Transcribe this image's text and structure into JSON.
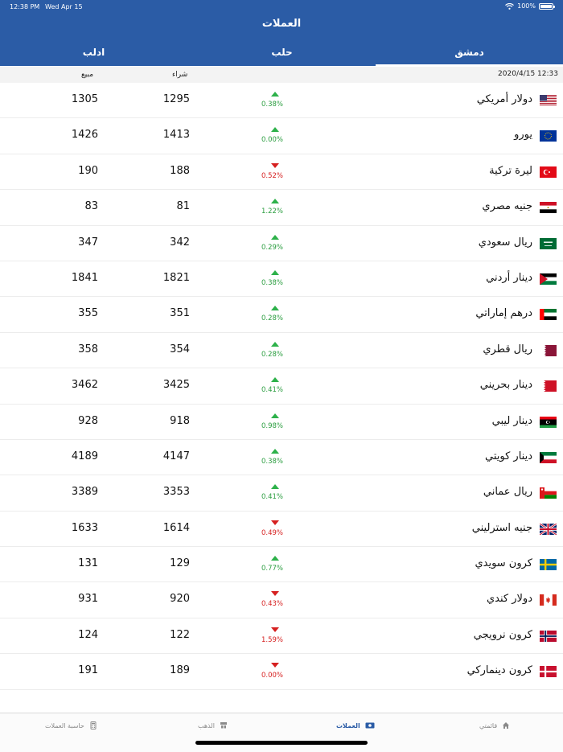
{
  "status_bar": {
    "time": "12:38 PM",
    "date": "Wed Apr 15",
    "battery": "100%"
  },
  "header": {
    "title": "العملات"
  },
  "tabs": [
    {
      "label": "دمشق",
      "active": true
    },
    {
      "label": "حلب",
      "active": false
    },
    {
      "label": "ادلب",
      "active": false
    }
  ],
  "subheader": {
    "updated": "2020/4/15 12:33",
    "buy_label": "شراء",
    "sell_label": "مبيع"
  },
  "colors": {
    "primary": "#2b5ca6",
    "up": "#2db14a",
    "down": "#d62020"
  },
  "currencies": [
    {
      "name": "دولار أمريكي",
      "flag": "us-flag",
      "direction": "up",
      "change": "0.38%",
      "buy": "1295",
      "sell": "1305"
    },
    {
      "name": "يورو",
      "flag": "eu-flag",
      "direction": "up",
      "change": "0.00%",
      "buy": "1413",
      "sell": "1426"
    },
    {
      "name": "ليرة تركية",
      "flag": "tr-flag",
      "direction": "down",
      "change": "0.52%",
      "buy": "188",
      "sell": "190"
    },
    {
      "name": "جنيه مصري",
      "flag": "eg-flag",
      "direction": "up",
      "change": "1.22%",
      "buy": "81",
      "sell": "83"
    },
    {
      "name": "ريال سعودي",
      "flag": "sa-flag",
      "direction": "up",
      "change": "0.29%",
      "buy": "342",
      "sell": "347"
    },
    {
      "name": "دينار أردني",
      "flag": "jo-flag",
      "direction": "up",
      "change": "0.38%",
      "buy": "1821",
      "sell": "1841"
    },
    {
      "name": "درهم إماراتي",
      "flag": "ae-flag",
      "direction": "up",
      "change": "0.28%",
      "buy": "351",
      "sell": "355"
    },
    {
      "name": "ريال قطري",
      "flag": "qa-flag",
      "direction": "up",
      "change": "0.28%",
      "buy": "354",
      "sell": "358"
    },
    {
      "name": "دينار بحريني",
      "flag": "bh-flag",
      "direction": "up",
      "change": "0.41%",
      "buy": "3425",
      "sell": "3462"
    },
    {
      "name": "دينار ليبي",
      "flag": "ly-flag",
      "direction": "up",
      "change": "0.98%",
      "buy": "918",
      "sell": "928"
    },
    {
      "name": "دينار كويتي",
      "flag": "kw-flag",
      "direction": "up",
      "change": "0.38%",
      "buy": "4147",
      "sell": "4189"
    },
    {
      "name": "ريال عماني",
      "flag": "om-flag",
      "direction": "up",
      "change": "0.41%",
      "buy": "3353",
      "sell": "3389"
    },
    {
      "name": "جنيه استرليني",
      "flag": "gb-flag",
      "direction": "down",
      "change": "0.49%",
      "buy": "1614",
      "sell": "1633"
    },
    {
      "name": "كرون سويدي",
      "flag": "se-flag",
      "direction": "up",
      "change": "0.77%",
      "buy": "129",
      "sell": "131"
    },
    {
      "name": "دولار كندي",
      "flag": "ca-flag",
      "direction": "down",
      "change": "0.43%",
      "buy": "920",
      "sell": "931"
    },
    {
      "name": "كرون نرويجي",
      "flag": "no-flag",
      "direction": "down",
      "change": "1.59%",
      "buy": "122",
      "sell": "124"
    },
    {
      "name": "كرون دينماركي",
      "flag": "dk-flag",
      "direction": "down",
      "change": "0.00%",
      "buy": "189",
      "sell": "191"
    }
  ],
  "tabbar": [
    {
      "label": "قائمتي",
      "icon": "home-icon",
      "active": false
    },
    {
      "label": "العملات",
      "icon": "currency-icon",
      "active": true
    },
    {
      "label": "الذهب",
      "icon": "gold-icon",
      "active": false
    },
    {
      "label": "حاسبة العملات",
      "icon": "calculator-icon",
      "active": false
    }
  ]
}
